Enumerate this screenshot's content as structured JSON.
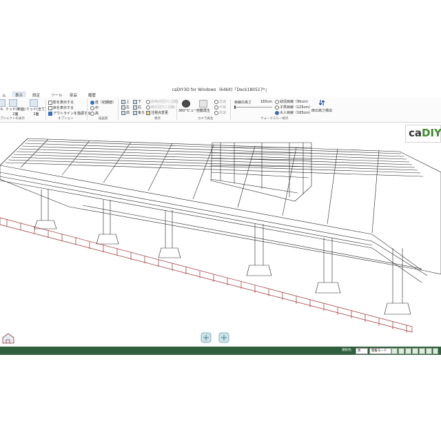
{
  "app": {
    "title": "caDIY3D for Windows（64bit)「Deck180517*」"
  },
  "menu": {
    "items": [
      {
        "label": "ム"
      },
      {
        "label": "表示"
      },
      {
        "label": "設定"
      },
      {
        "label": "ツール"
      },
      {
        "label": "部品"
      },
      {
        "label": "履歴"
      }
    ]
  },
  "ribbon": {
    "object_display": {
      "btn1": "ル",
      "btn2": "ミッド(断面)\n2面",
      "btn3": "ミッド(全て)\n2面",
      "group_label": "ブジェクトの表示"
    },
    "options": {
      "items": [
        {
          "label": "影を表示する",
          "checked": false
        },
        {
          "label": "床を表示する",
          "checked": false
        },
        {
          "label": "アウトラインを強調する",
          "checked": true
        }
      ],
      "group_label": "オプション"
    },
    "quality": {
      "items": [
        {
          "label": "低（初期値）",
          "selected": true
        },
        {
          "label": "中",
          "selected": false
        },
        {
          "label": "高",
          "selected": false
        }
      ],
      "group_label": "描画質"
    },
    "viewpoint": {
      "dirs": [
        "上",
        "下",
        "左",
        "右",
        "前",
        "後ろ"
      ],
      "rotate_cw": "反時計回りに回転",
      "rotate_ccw": "時計回りに回転",
      "change": "注視点変更",
      "group_label": "視点"
    },
    "camera": {
      "view360": "360°ビュー",
      "autoplay": "自動再生",
      "speed_low": "低速",
      "speed_mid": "中速",
      "speed_high": "高速",
      "group_label": "カメラ再生"
    },
    "walkthrough": {
      "eye_height_label": "目線の高さ",
      "eye_height_value": "165cm",
      "options": [
        {
          "label": "幼児目線（95cm）",
          "selected": false
        },
        {
          "label": "子供目線（125cm）",
          "selected": false
        },
        {
          "label": "大人目線（165cm）",
          "selected": true
        }
      ],
      "floor_height": "床の高さ検出",
      "group_label": "ウォークスルー視点"
    }
  },
  "logo": {
    "text_ca": "ca",
    "text_diy": "DIY"
  },
  "status": {
    "mode_label": "選択色：",
    "mode_value": "黒",
    "view_value": "閲覧モード"
  },
  "colors": {
    "statusbar": "#2f5f3c",
    "footing_row": "#9b2b2b",
    "wireframe": "#222222",
    "logo_green": "#3d8a2a"
  }
}
